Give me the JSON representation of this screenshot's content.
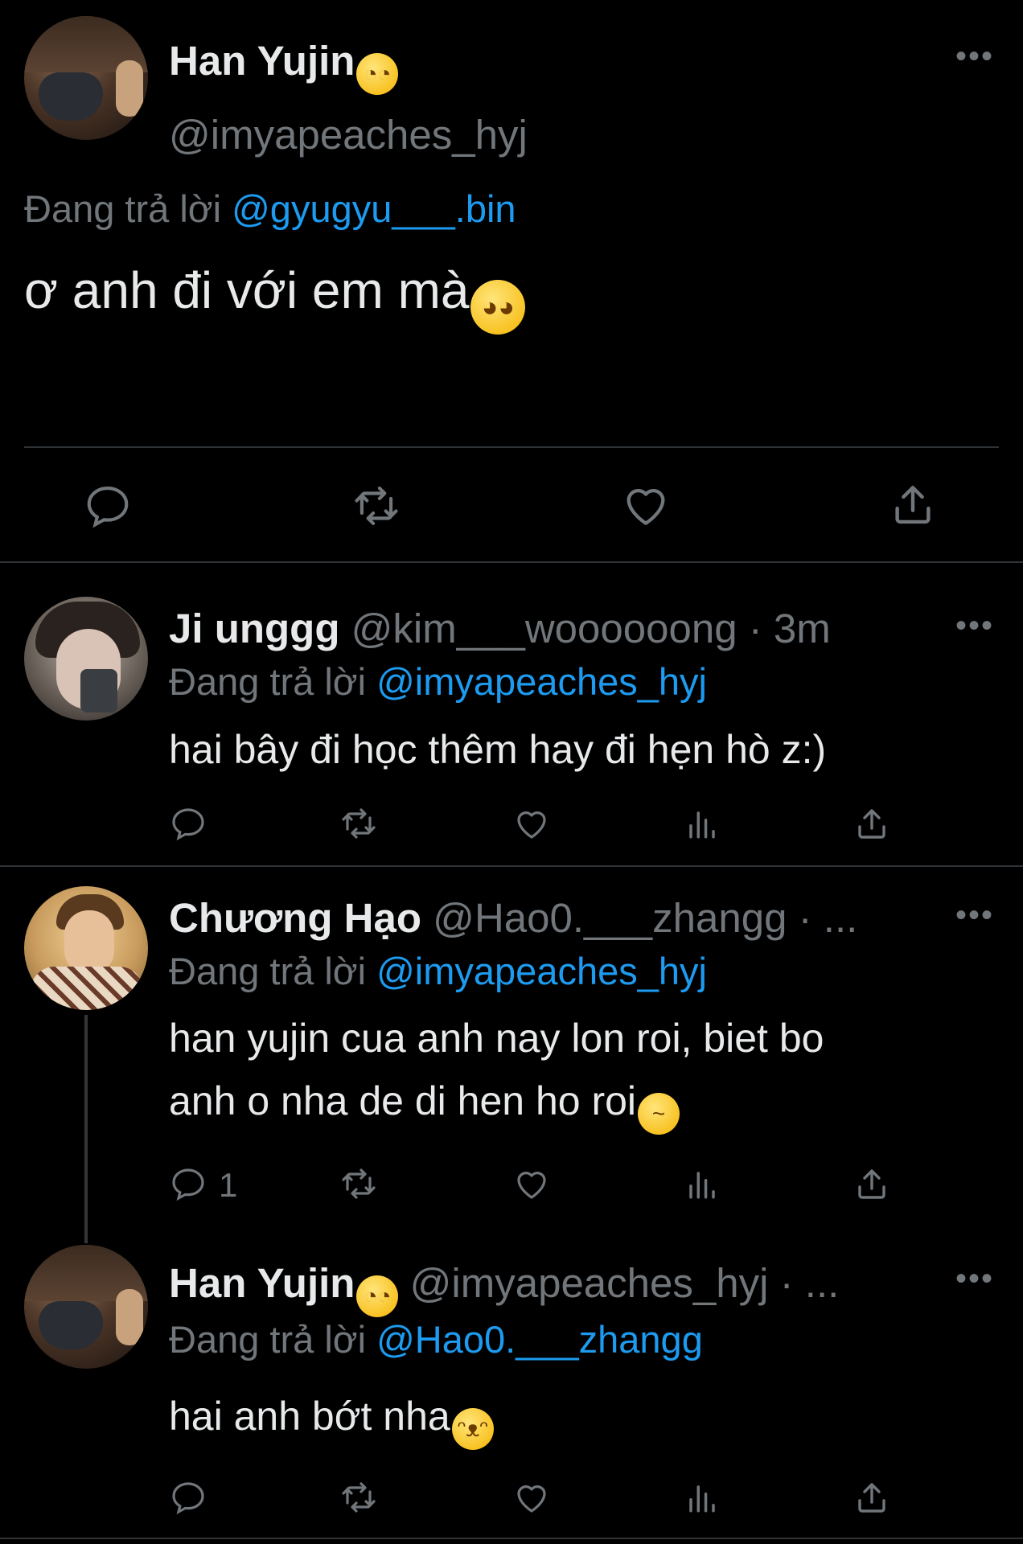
{
  "main_tweet": {
    "name": "Han Yujin",
    "name_emoji": "🥸",
    "handle": "@imyapeaches_hyj",
    "reply_prefix": "Đang trả lời",
    "reply_to": "@gyugyu___.bin",
    "text": "ơ anh đi với em mà",
    "text_emoji": "🥹",
    "more": "•••",
    "actions": [
      "reply-icon",
      "retweet-icon",
      "like-icon",
      "share-icon"
    ]
  },
  "replies": [
    {
      "name": "Ji unggg",
      "handle": "@kim___woooooong",
      "time": "· 3m",
      "reply_prefix": "Đang trả lời",
      "reply_to": "@imyapeaches_hyj",
      "text_line1": "hai bây đi học thêm hay đi hẹn hò z:)",
      "more": "•••",
      "reply_count": ""
    },
    {
      "name": "Chương Hạo",
      "handle": "@Hao0.___zhangg",
      "time": "· ...",
      "reply_prefix": "Đang trả lời",
      "reply_to": "@imyapeaches_hyj",
      "text_line1": "han yujin cua anh nay lon roi, biet bo",
      "text_line2": "anh o nha de di hen ho roi",
      "text_emoji": "🥴",
      "more": "•••",
      "reply_count": "1"
    },
    {
      "name": "Han Yujin",
      "name_emoji": "🥸",
      "handle": "@imyapeaches_hyj",
      "time": "· ...",
      "reply_prefix": "Đang trả lời",
      "reply_to": "@Hao0.___zhangg",
      "text_line1": "hai anh bớt nha",
      "text_emoji": "😾",
      "more": "•••",
      "reply_count": ""
    }
  ],
  "colors": {
    "background": "#000000",
    "text": "#e7e9ea",
    "secondary": "#71767b",
    "mention": "#1d9bf0",
    "divider": "#2f3336"
  }
}
